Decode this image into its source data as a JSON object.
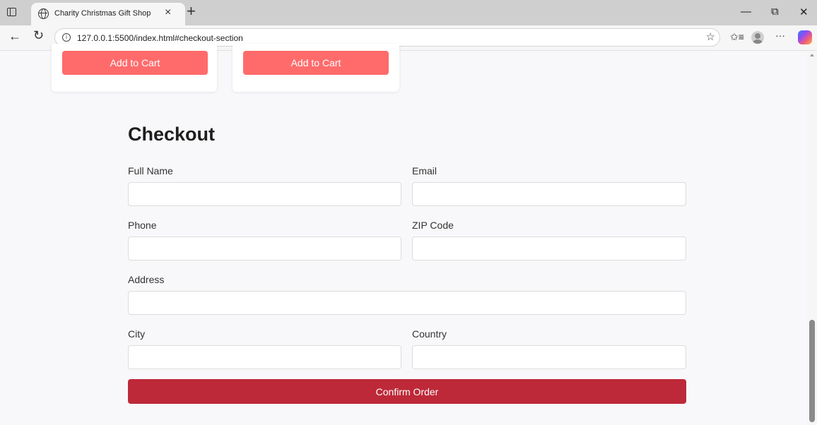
{
  "browser": {
    "tab_title": "Charity Christmas Gift Shop",
    "tab_close": "×",
    "new_tab": "+",
    "url": "127.0.0.1:5500/index.html#checkout-section",
    "minimize": "—",
    "restore": "⧉",
    "close": "✕",
    "icons": [
      "sidebar-toggle-icon",
      "globe-icon",
      "back-arrow-icon",
      "reload-icon",
      "info-icon",
      "star-icon",
      "favorites-icon",
      "profile-avatar-icon",
      "more-icon",
      "copilot-icon"
    ]
  },
  "products": [
    {
      "button_label": "Add to Cart"
    },
    {
      "button_label": "Add to Cart"
    }
  ],
  "checkout": {
    "title": "Checkout",
    "fields": {
      "full_name": {
        "label": "Full Name",
        "value": ""
      },
      "email": {
        "label": "Email",
        "value": ""
      },
      "phone": {
        "label": "Phone",
        "value": ""
      },
      "zip": {
        "label": "ZIP Code",
        "value": ""
      },
      "address": {
        "label": "Address",
        "value": ""
      },
      "city": {
        "label": "City",
        "value": ""
      },
      "country": {
        "label": "Country",
        "value": ""
      }
    },
    "confirm_label": "Confirm Order"
  },
  "colors": {
    "add_to_cart": "#ff6b6b",
    "confirm": "#bd2938",
    "page_bg": "#f8f8fa"
  }
}
